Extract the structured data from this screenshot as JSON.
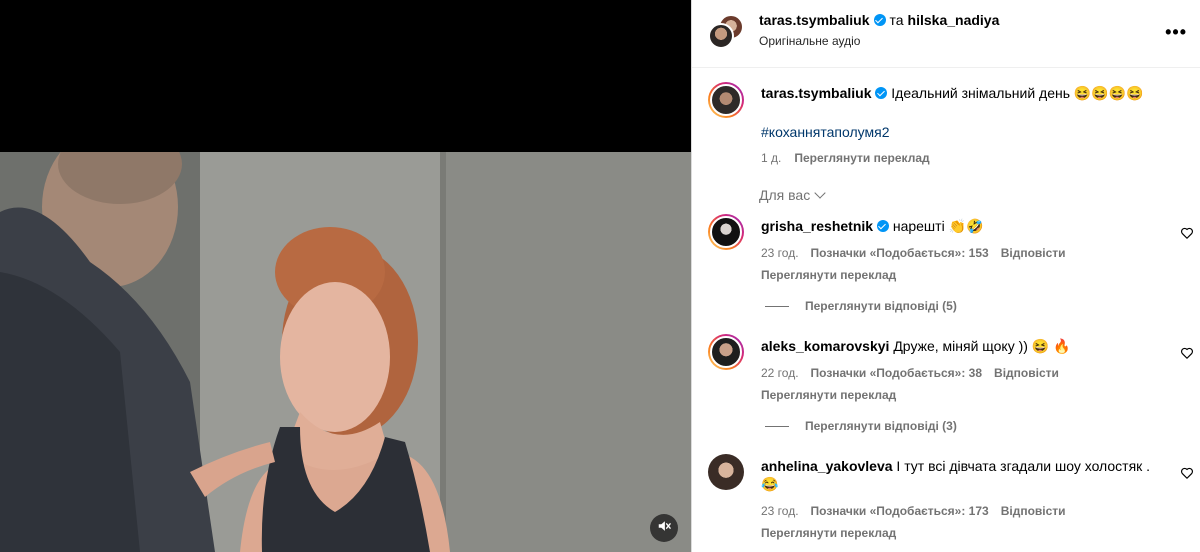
{
  "header": {
    "author": "taras.tsymbaliuk",
    "and": "та",
    "coauthor": "hilska_nadiya",
    "audio": "Оригінальне аудіо",
    "more": "•••"
  },
  "caption": {
    "username": "taras.tsymbaliuk",
    "text": "Ідеальний знімальний день 😆😆😆😆",
    "hashtag": "#коханнятаполумя2",
    "time": "1 д.",
    "translate": "Переглянути переклад"
  },
  "for_you": "Для вас",
  "comments": [
    {
      "username": "grisha_reshetnik",
      "verified": true,
      "text": "нарешті 👏🤣",
      "time": "23 год.",
      "likes": "Позначки «Подобається»: 153",
      "reply": "Відповісти",
      "translate": "Переглянути переклад",
      "view_replies": "Переглянути відповіді (5)"
    },
    {
      "username": "aleks_komarovskyi",
      "verified": false,
      "text": "Друже, міняй щоку )) 😆 🔥",
      "time": "22 год.",
      "likes": "Позначки «Подобається»: 38",
      "reply": "Відповісти",
      "translate": "Переглянути переклад",
      "view_replies": "Переглянути відповіді (3)"
    },
    {
      "username": "anhelina_yakovleva",
      "verified": false,
      "text": "І тут всі дівчата згадали шоу холостяк . 😂",
      "time": "23 год.",
      "likes": "Позначки «Подобається»: 173",
      "reply": "Відповісти",
      "translate": "Переглянути переклад"
    }
  ],
  "colors": {
    "verified": "#0095f6",
    "hashtag": "#00376b",
    "secondary_text": "#737373"
  },
  "icons": {
    "mute": "speaker-muted-icon",
    "like": "heart-outline-icon",
    "more": "more-horizontal-icon"
  }
}
